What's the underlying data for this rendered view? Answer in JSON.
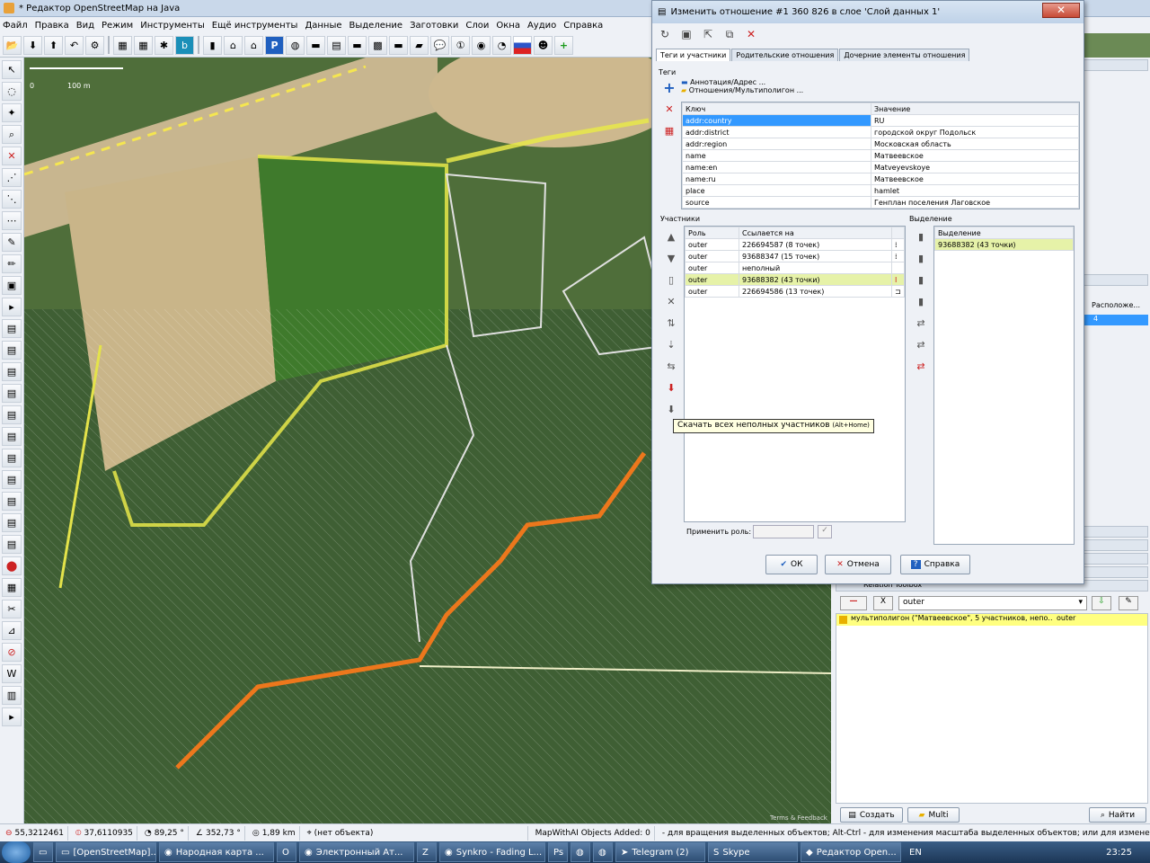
{
  "app": {
    "title": "* Редактор OpenStreetMap на Java"
  },
  "menu": [
    "Файл",
    "Правка",
    "Вид",
    "Режим",
    "Инструменты",
    "Ещё инструменты",
    "Данные",
    "Выделение",
    "Заготовки",
    "Слои",
    "Окна",
    "Аудио",
    "Справка"
  ],
  "map": {
    "scale_label": "100 m",
    "scale_zero": "0",
    "attribution": "Terms & Feedback"
  },
  "dialog": {
    "title": "Изменить отношение #1 360 826 в слое 'Слой данных 1'",
    "tabs": [
      "Теги и участники",
      "Родительские отношения",
      "Дочерние элементы отношения"
    ],
    "tags_label": "Теги",
    "presets": [
      "Аннотация/Адрес ...",
      "Отношения/Мультиполигон ..."
    ],
    "tags_headers": {
      "key": "Ключ",
      "value": "Значение"
    },
    "tags": [
      {
        "key": "addr:country",
        "value": "RU"
      },
      {
        "key": "addr:district",
        "value": "городской округ Подольск"
      },
      {
        "key": "addr:region",
        "value": "Московская область"
      },
      {
        "key": "name",
        "value": "Матвеевское"
      },
      {
        "key": "name:en",
        "value": "Matveyevskoye"
      },
      {
        "key": "name:ru",
        "value": "Матвеевское"
      },
      {
        "key": "place",
        "value": "hamlet"
      },
      {
        "key": "source",
        "value": "Генплан поселения Лаговское"
      }
    ],
    "members_label": "Участники",
    "members_headers": {
      "role": "Роль",
      "ref": "Ссылается на"
    },
    "members": [
      {
        "role": "outer",
        "ref": "226694587 (8 точек)"
      },
      {
        "role": "outer",
        "ref": "93688347 (15 точек)"
      },
      {
        "role": "outer",
        "ref": "неполный"
      },
      {
        "role": "outer",
        "ref": "93688382 (43 точки)"
      },
      {
        "role": "outer",
        "ref": "226694586 (13 точек)"
      }
    ],
    "selection_label": "Выделение",
    "selection_header": "Выделение",
    "selection_items": [
      "93688382 (43 точки)"
    ],
    "apply_role_label": "Применить роль:",
    "tooltip": "Скачать всех неполных участников",
    "tooltip_shortcut": "(Alt+Home)",
    "buttons": {
      "ok": "ОК",
      "cancel": "Отмена",
      "help": "Справка"
    }
  },
  "right_panel": {
    "location_label": "Расположе...",
    "location_value": "4",
    "toolbox_title": "Relation Toolbox",
    "role_value": "outer",
    "relation_entry": "мультиполигон (\"Матвеевское\", 5 участников, непо...",
    "relation_role": "outer",
    "create_label": "Создать",
    "multi_label": "Multi",
    "find_label": "Найти"
  },
  "status": {
    "lat": "55,3212461",
    "lon": "37,6110935",
    "heading": "89,25 °",
    "angle": "352,73 °",
    "distance": "1,89 km",
    "object": "(нет объекта)",
    "mapwithai": "MapWithAI Objects Added: 0",
    "hint": "- для вращения выделенных объектов; Alt-Ctrl - для изменения масштаба выделенных объектов; или для изменения выделения"
  },
  "taskbar": {
    "items": [
      "[OpenStreetMap]...",
      "Народная карта ...",
      "",
      "Электронный Ат...",
      "",
      "Synkro - Fading L...",
      "",
      "",
      "",
      "Telegram (2)",
      "Skype",
      "Редактор Open..."
    ],
    "lang": "EN",
    "time": "23:25"
  },
  "colors": {
    "selected_row": "#e6f2a8",
    "selection_yellow": "#ffff00",
    "route_orange": "#ff7a1a"
  }
}
